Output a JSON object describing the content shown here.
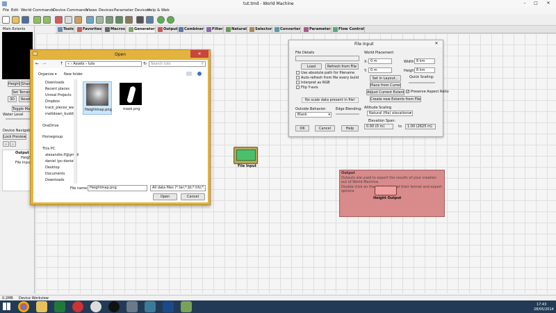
{
  "app": {
    "title": "tut.tmd - World Machine",
    "menu": [
      "File",
      "Edit",
      "World Commands",
      "Device Commands",
      "Views",
      "Devices",
      "Parameter Devices",
      "Help & Web"
    ],
    "tabs": [
      "Tools",
      "Favorites",
      "Macros",
      "Generator",
      "Output",
      "Combiner",
      "Filter",
      "Natural",
      "Selector",
      "Converter",
      "Parameter",
      "Flow Control"
    ]
  },
  "left_panel": {
    "title": "Main Extents",
    "buttons": [
      "Height",
      "Shade",
      "Set Terrain",
      "3D",
      "Reset",
      "Toggle Map"
    ],
    "water_level": "Water Level",
    "device_nav": "Device Navigation",
    "lock_preview": "Lock Preview",
    "tree": [
      "Output",
      "Height",
      "File Input"
    ]
  },
  "open_dialog": {
    "title": "Open",
    "breadcrumb": [
      "«",
      "Assets",
      "tuts"
    ],
    "search_placeholder": "Search tuts",
    "organize": "Organize ▾",
    "new_folder": "New folder",
    "nav_items": [
      "Downloads",
      "Recent places",
      "Unreal Projects",
      "Dropbox",
      "track_pieces_wall",
      "meltdown_buddy",
      "OneDrive",
      "Homegroup",
      "This PC",
      "alexandre.lf@gmail",
      "daniel (pc-daniel)",
      "Desktop",
      "Documents",
      "Downloads"
    ],
    "files": [
      "Heightmap.png",
      "mask.png"
    ],
    "file_name_label": "File name:",
    "file_name_value": "Heightmap.png",
    "file_type": "All data files (*.ter;*.bt;*.hfz;*.hf",
    "open_btn": "Open",
    "cancel_btn": "Cancel"
  },
  "file_input": {
    "title": "File Input",
    "file_details": "File Details",
    "load": "Load",
    "refresh": "Refresh from File",
    "checks": [
      "Use absolute path for filename",
      "Auto-refresh from file every build",
      "Interpret as RGB",
      "Flip Y-axis"
    ],
    "scale_note": "No scale data present in file!",
    "outside_behavior": "Outside Behavior:",
    "outside_value": "Blank",
    "edge_blending": "Edge Blending:",
    "world_placement": "World Placement",
    "x_label": "X:",
    "x_val": "0 m",
    "y_label": "Y:",
    "y_val": "0 m",
    "width_label": "Width:",
    "width_val": "8 km",
    "height_label": "Height:",
    "height_val": "8 km",
    "set_layout": "Set in Layout...",
    "quick_scaling": "Quick Scaling:",
    "place_current": "Place from Current",
    "adjust_extents": "Adjust Current Extents",
    "preserve_aspect": "Preserve Aspect Ratio",
    "create_extents": "Create new Extents from File",
    "altitude_scaling": "Altitude Scaling",
    "altitude_value": "Natural (file) elevations",
    "elevation_span": "Elevation Span:",
    "elev_from": "0.00 (0 m)",
    "elev_to_label": "to",
    "elev_to": "1.00 (2625 m)",
    "ok": "OK",
    "cancel": "Cancel",
    "help": "Help"
  },
  "canvas": {
    "file_input_node": "File Input",
    "output_group_title": "Output",
    "output_text_1": "Outputs are used to export the results of your creation out of World Machine.",
    "output_text_2": "Double click on the devices to set their format and export options.",
    "height_output_node": "Height Output"
  },
  "status": {
    "memory": "0.2MB",
    "mode": "Device Workview"
  },
  "taskbar": {
    "time": "17:43",
    "date": "28/05/2014"
  },
  "colors": {
    "accent": "#7e91ad",
    "output_group": "#d98a8a",
    "node_file_input": "#66b266",
    "taskbar": "#223a55"
  }
}
